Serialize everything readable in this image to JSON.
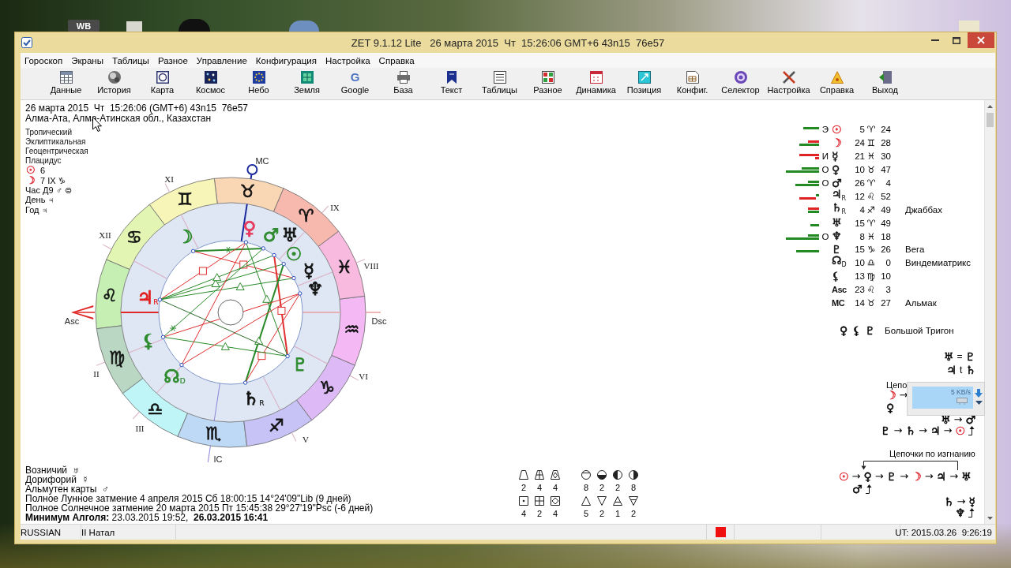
{
  "desktop": {
    "shortcut_label": "WB"
  },
  "window": {
    "title": "ZET 9.1.12 Lite   26 марта 2015  Чт  15:26:06 GMT+6 43n15  76e57"
  },
  "menu": [
    "Гороскоп",
    "Экраны",
    "Таблицы",
    "Разное",
    "Управление",
    "Конфигурация",
    "Настройка",
    "Справка"
  ],
  "toolbar": [
    {
      "label": "Данные"
    },
    {
      "label": "История"
    },
    {
      "label": "Карта"
    },
    {
      "label": "Космос"
    },
    {
      "label": "Небо"
    },
    {
      "label": "Земля"
    },
    {
      "label": "Google",
      "icon_text": "G"
    },
    {
      "label": "База"
    },
    {
      "label": "Текст"
    },
    {
      "label": "Таблицы"
    },
    {
      "label": "Разное"
    },
    {
      "label": "Динамика"
    },
    {
      "label": "Позиция"
    },
    {
      "label": "Конфиг."
    },
    {
      "label": "Селектор"
    },
    {
      "label": "Настройка"
    },
    {
      "label": "Справка"
    },
    {
      "label": "Выход"
    }
  ],
  "header": {
    "datetime": "26 марта 2015  Чт  15:26:06 (GMT+6) 43n15  76e57",
    "place": "Алма-Ата, Алма-Атинская обл., Казахстан"
  },
  "settings": [
    "Тропический",
    "Эклиптикальная",
    "Геоцентрическая",
    "Плацидус"
  ],
  "rulers": [
    {
      "symbol": {
        "glyph": "☉",
        "color": "#e0303a"
      },
      "text": "6"
    },
    {
      "symbol": {
        "glyph": "☽",
        "color": "#e0303a"
      },
      "text": "7 IX ♑"
    },
    {
      "text": "Час Д9 ♂ ⊜"
    },
    {
      "text": "День ♃"
    },
    {
      "text": "Год ♃"
    }
  ],
  "wheel": {
    "signs": [
      {
        "glyph": "♈",
        "color": "#f7b9ae"
      },
      {
        "glyph": "♉",
        "color": "#f9d7b5"
      },
      {
        "glyph": "♊",
        "color": "#f8f5b8"
      },
      {
        "glyph": "♋",
        "color": "#e3f5b3"
      },
      {
        "glyph": "♌",
        "color": "#c6efb3"
      },
      {
        "glyph": "♍",
        "color": "#b9d7c2"
      },
      {
        "glyph": "♎",
        "color": "#c0f5f7"
      },
      {
        "glyph": "♏",
        "color": "#bdd9f6"
      },
      {
        "glyph": "♐",
        "color": "#c7c3f6"
      },
      {
        "glyph": "♑",
        "color": "#ddbaf6"
      },
      {
        "glyph": "♒",
        "color": "#f4b9f5"
      },
      {
        "glyph": "♓",
        "color": "#f8badf"
      }
    ],
    "cusps": [
      {
        "kind": "asc",
        "label": "Asc"
      },
      {
        "kind": "house",
        "label": "II"
      },
      {
        "kind": "house",
        "label": "III"
      },
      {
        "kind": "ic",
        "label": "IC"
      },
      {
        "kind": "house",
        "label": "V"
      },
      {
        "kind": "house",
        "label": "VI"
      },
      {
        "kind": "dsc",
        "label": "Dsc"
      },
      {
        "kind": "house",
        "label": "VIII"
      },
      {
        "kind": "house",
        "label": "IX"
      },
      {
        "kind": "mc",
        "label": "MC"
      },
      {
        "kind": "house",
        "label": "XI"
      },
      {
        "kind": "house",
        "label": "XII"
      }
    ],
    "planets": [
      {
        "glyph": "☽",
        "color": "#2e8b2e"
      },
      {
        "glyph": "♀",
        "color": "#e8385c"
      },
      {
        "glyph": "♂",
        "color": "#2e8b2e"
      },
      {
        "glyph": "♅",
        "color": "#111111"
      },
      {
        "glyph": "☉",
        "color": "#2e8b2e"
      },
      {
        "glyph": "☿",
        "color": "#111111"
      },
      {
        "glyph": "♆",
        "color": "#111111"
      },
      {
        "glyph": "♇",
        "color": "#2e8b2e"
      },
      {
        "glyph": "♄",
        "suffix": "R",
        "color": "#111111"
      },
      {
        "glyph": "☊",
        "suffix": "D",
        "color": "#2e8b2e"
      },
      {
        "glyph": "⚸",
        "color": "#2e8b2e"
      },
      {
        "glyph": "♃",
        "suffix": "R",
        "color": "#e02020"
      }
    ]
  },
  "notes": [
    "Возничий  ♅",
    "Дорифорий  ☿",
    "Альмутен карты  ♂",
    "Полное Лунное затмение 4 апреля 2015 Сб 18:00:15 14°24'09\"Lib (9 дней)",
    "Полное Солнечное затмение 20 марта 2015 Пт 15:45:38 29°27'19\"Psc (-6 дней)",
    "**Минимум Алголя:** 23.03.2015 19:52,  **26.03.2015 16:41**"
  ],
  "symbol_counts": [
    [
      "2",
      "4",
      "4",
      "4",
      "2",
      "4"
    ],
    [
      "8",
      "2",
      "2",
      "8",
      "5",
      "2",
      "1",
      "2"
    ]
  ],
  "positions": [
    {
      "mark": "Э",
      "planet": {
        "kind": "planet",
        "glyph": "☉",
        "color": "#e0303a"
      },
      "degree": "5",
      "sign": "♈",
      "minutes": "24"
    },
    {
      "planet": {
        "kind": "planet",
        "glyph": "☽",
        "color": "#e0303a"
      },
      "degree": "24",
      "sign": "♊",
      "minutes": "28"
    },
    {
      "mark": "И",
      "planet": {
        "kind": "planet",
        "glyph": "☿",
        "color": "#111111"
      },
      "degree": "21",
      "sign": "♓",
      "minutes": "30"
    },
    {
      "mark": "О",
      "planet": {
        "kind": "planet",
        "glyph": "♀",
        "color": "#111111"
      },
      "degree": "10",
      "sign": "♉",
      "minutes": "47"
    },
    {
      "mark": "О",
      "planet": {
        "kind": "planet",
        "glyph": "♂",
        "color": "#111111"
      },
      "degree": "26",
      "sign": "♈",
      "minutes": "4"
    },
    {
      "planet": {
        "kind": "planet",
        "glyph": "♃",
        "suffix": "R",
        "color": "#111111"
      },
      "degree": "12",
      "sign": "♌",
      "minutes": "52"
    },
    {
      "planet": {
        "kind": "planet",
        "glyph": "♄",
        "suffix": "R",
        "color": "#111111"
      },
      "degree": "4",
      "sign": "♐",
      "minutes": "49",
      "star": "Джаббах"
    },
    {
      "planet": {
        "kind": "planet",
        "glyph": "♅",
        "color": "#111111"
      },
      "degree": "15",
      "sign": "♈",
      "minutes": "49"
    },
    {
      "mark": "О",
      "planet": {
        "kind": "planet",
        "glyph": "♆",
        "color": "#111111"
      },
      "degree": "8",
      "sign": "♓",
      "minutes": "18"
    },
    {
      "planet": {
        "kind": "planet",
        "glyph": "♇",
        "color": "#111111"
      },
      "degree": "15",
      "sign": "♑",
      "minutes": "26",
      "star": "Вега"
    },
    {
      "planet": {
        "kind": "planet",
        "glyph": "☊",
        "suffix": "D",
        "color": "#111111"
      },
      "degree": "10",
      "sign": "♎",
      "minutes": "0",
      "star": "Виндемиатрикс"
    },
    {
      "planet": {
        "kind": "planet",
        "glyph": "⚸",
        "color": "#111111"
      },
      "degree": "13",
      "sign": "♍",
      "minutes": "10"
    },
    {
      "planet": {
        "kind": "angle",
        "glyph": "Asc",
        "color": "#111111"
      },
      "degree": "23",
      "sign": "♌",
      "minutes": "3"
    },
    {
      "planet": {
        "kind": "angle",
        "glyph": "MC",
        "color": "#111111"
      },
      "degree": "14",
      "sign": "♉",
      "minutes": "27",
      "star": "Альмак"
    }
  ],
  "aspect_figure": {
    "symbols": [
      {
        "kind": "planet",
        "text": "♀"
      },
      {
        "kind": "planet",
        "text": "⚸"
      },
      {
        "kind": "planet",
        "text": "♇"
      }
    ],
    "name": "Большой Тригон"
  },
  "relations": [
    [
      {
        "kind": "planet",
        "text": "♅"
      },
      {
        "kind": "operator",
        "text": "="
      },
      {
        "kind": "planet",
        "text": "♇"
      }
    ],
    [
      {
        "kind": "planet",
        "text": "♃"
      },
      {
        "kind": "operator",
        "text": "t"
      },
      {
        "kind": "planet",
        "text": "♄"
      }
    ]
  ],
  "rulership_chains": {
    "title": "Цепо",
    "lines": [
      [
        {
          "kind": "planet",
          "text": "☽",
          "color": "#e0303a"
        },
        {
          "kind": "arrow",
          "text": "→"
        }
      ],
      [
        {
          "kind": "planet",
          "text": "♀"
        }
      ],
      [
        {
          "kind": "planet",
          "text": "♅"
        },
        {
          "kind": "arrow",
          "text": "→"
        },
        {
          "kind": "planet",
          "text": "♂"
        }
      ],
      [
        {
          "kind": "planet",
          "text": "♇"
        },
        {
          "kind": "arrow",
          "text": "→"
        },
        {
          "kind": "planet",
          "text": "♄"
        },
        {
          "kind": "arrow",
          "text": "→"
        },
        {
          "kind": "planet",
          "text": "♃"
        },
        {
          "kind": "arrow",
          "text": "→"
        },
        {
          "kind": "planet",
          "text": "☉",
          "color": "#e0303a"
        },
        {
          "kind": "hook"
        }
      ]
    ]
  },
  "exile_chains": {
    "title": "Цепочки по изгнанию",
    "chains": [
      {
        "loop": true,
        "line": [
          {
            "kind": "planet",
            "text": "☉",
            "color": "#e0303a"
          },
          {
            "kind": "arrow",
            "text": "→"
          },
          {
            "kind": "planet",
            "text": "♀"
          },
          {
            "kind": "arrow",
            "text": "→"
          },
          {
            "kind": "planet",
            "text": "♇"
          },
          {
            "kind": "arrow",
            "text": "→"
          },
          {
            "kind": "planet",
            "text": "☽",
            "color": "#e0303a"
          },
          {
            "kind": "arrow",
            "text": "→"
          },
          {
            "kind": "planet",
            "text": "♃"
          },
          {
            "kind": "arrow",
            "text": "→"
          },
          {
            "kind": "planet",
            "text": "♅"
          }
        ],
        "branch": [
          {
            "kind": "planet",
            "text": "♂"
          },
          {
            "kind": "hook"
          }
        ]
      },
      {
        "loop": false,
        "line": [
          {
            "kind": "planet",
            "text": "♄"
          },
          {
            "kind": "arrow",
            "text": "→"
          },
          {
            "kind": "planet",
            "text": "☿"
          }
        ],
        "branch": [
          {
            "kind": "planet",
            "text": "♆"
          },
          {
            "kind": "hook"
          }
        ]
      }
    ]
  },
  "speed_widget": {
    "reading": "5 KB/s"
  },
  "status_bar": {
    "language": "RUSSIAN",
    "mode": "II Натал",
    "time": "UT: 2015.03.26  9:26:19"
  }
}
